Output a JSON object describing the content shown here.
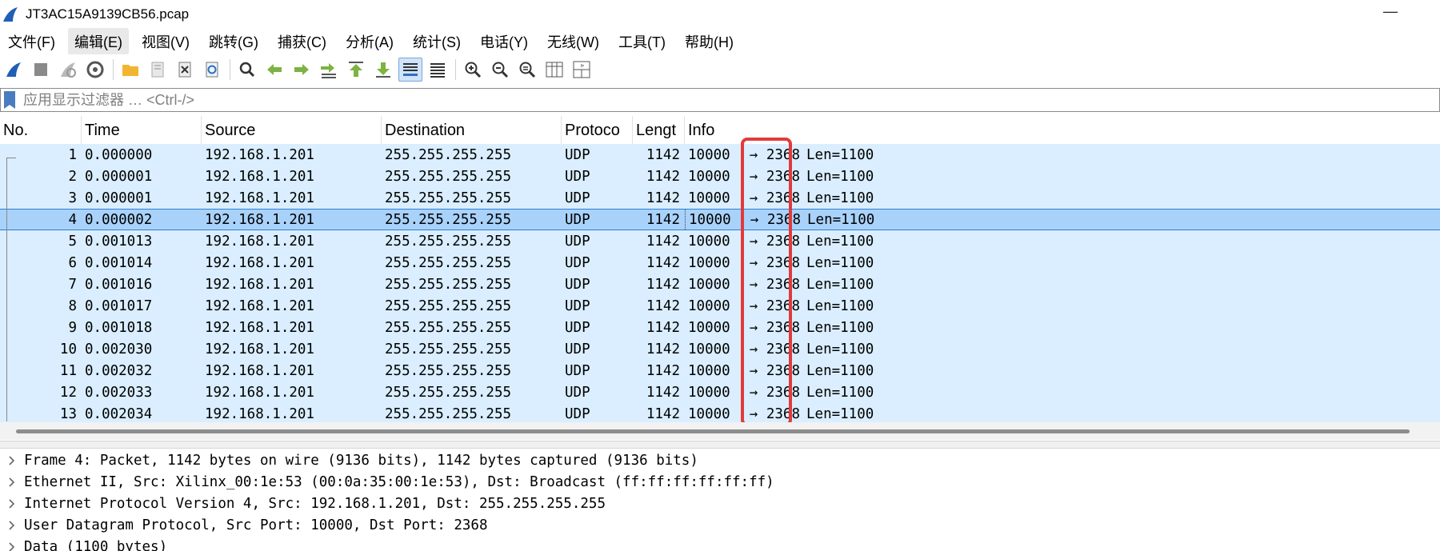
{
  "window": {
    "title": "JT3AC15A9139CB56.pcap",
    "minimize_glyph": "—"
  },
  "menu": [
    "文件(F)",
    "编辑(E)",
    "视图(V)",
    "跳转(G)",
    "捕获(C)",
    "分析(A)",
    "统计(S)",
    "电话(Y)",
    "无线(W)",
    "工具(T)",
    "帮助(H)"
  ],
  "toolbar": {
    "icons": [
      "start-capture-icon",
      "stop-capture-icon",
      "restart-capture-icon",
      "capture-options-icon",
      "open-file-icon",
      "save-file-icon",
      "close-file-icon",
      "reload-file-icon",
      "find-packet-icon",
      "go-back-icon",
      "go-forward-icon",
      "go-to-packet-icon",
      "first-packet-icon",
      "last-packet-icon",
      "auto-scroll-icon",
      "colorize-icon",
      "zoom-in-icon",
      "zoom-out-icon",
      "zoom-normal-icon",
      "resize-columns-icon",
      "layout-icon"
    ]
  },
  "filter": {
    "placeholder": "应用显示过滤器 … <Ctrl-/>"
  },
  "packet_list": {
    "columns": [
      "No.",
      "Time",
      "Source",
      "Destination",
      "Protoco",
      "Lengt",
      "Info"
    ],
    "selected_no": "4",
    "rows": [
      {
        "no": "1",
        "time": "0.000000",
        "src": "192.168.1.201",
        "dst": "255.255.255.255",
        "proto": "UDP",
        "len": "1142",
        "info_src": "10000",
        "info_arrow": "→",
        "info_dst": "2368",
        "info_rest": "Len=1100"
      },
      {
        "no": "2",
        "time": "0.000001",
        "src": "192.168.1.201",
        "dst": "255.255.255.255",
        "proto": "UDP",
        "len": "1142",
        "info_src": "10000",
        "info_arrow": "→",
        "info_dst": "2368",
        "info_rest": "Len=1100"
      },
      {
        "no": "3",
        "time": "0.000001",
        "src": "192.168.1.201",
        "dst": "255.255.255.255",
        "proto": "UDP",
        "len": "1142",
        "info_src": "10000",
        "info_arrow": "→",
        "info_dst": "2368",
        "info_rest": "Len=1100"
      },
      {
        "no": "4",
        "time": "0.000002",
        "src": "192.168.1.201",
        "dst": "255.255.255.255",
        "proto": "UDP",
        "len": "1142",
        "info_src": "10000",
        "info_arrow": "→",
        "info_dst": "2368",
        "info_rest": "Len=1100"
      },
      {
        "no": "5",
        "time": "0.001013",
        "src": "192.168.1.201",
        "dst": "255.255.255.255",
        "proto": "UDP",
        "len": "1142",
        "info_src": "10000",
        "info_arrow": "→",
        "info_dst": "2368",
        "info_rest": "Len=1100"
      },
      {
        "no": "6",
        "time": "0.001014",
        "src": "192.168.1.201",
        "dst": "255.255.255.255",
        "proto": "UDP",
        "len": "1142",
        "info_src": "10000",
        "info_arrow": "→",
        "info_dst": "2368",
        "info_rest": "Len=1100"
      },
      {
        "no": "7",
        "time": "0.001016",
        "src": "192.168.1.201",
        "dst": "255.255.255.255",
        "proto": "UDP",
        "len": "1142",
        "info_src": "10000",
        "info_arrow": "→",
        "info_dst": "2368",
        "info_rest": "Len=1100"
      },
      {
        "no": "8",
        "time": "0.001017",
        "src": "192.168.1.201",
        "dst": "255.255.255.255",
        "proto": "UDP",
        "len": "1142",
        "info_src": "10000",
        "info_arrow": "→",
        "info_dst": "2368",
        "info_rest": "Len=1100"
      },
      {
        "no": "9",
        "time": "0.001018",
        "src": "192.168.1.201",
        "dst": "255.255.255.255",
        "proto": "UDP",
        "len": "1142",
        "info_src": "10000",
        "info_arrow": "→",
        "info_dst": "2368",
        "info_rest": "Len=1100"
      },
      {
        "no": "10",
        "time": "0.002030",
        "src": "192.168.1.201",
        "dst": "255.255.255.255",
        "proto": "UDP",
        "len": "1142",
        "info_src": "10000",
        "info_arrow": "→",
        "info_dst": "2368",
        "info_rest": "Len=1100"
      },
      {
        "no": "11",
        "time": "0.002032",
        "src": "192.168.1.201",
        "dst": "255.255.255.255",
        "proto": "UDP",
        "len": "1142",
        "info_src": "10000",
        "info_arrow": "→",
        "info_dst": "2368",
        "info_rest": "Len=1100"
      },
      {
        "no": "12",
        "time": "0.002033",
        "src": "192.168.1.201",
        "dst": "255.255.255.255",
        "proto": "UDP",
        "len": "1142",
        "info_src": "10000",
        "info_arrow": "→",
        "info_dst": "2368",
        "info_rest": "Len=1100"
      },
      {
        "no": "13",
        "time": "0.002034",
        "src": "192.168.1.201",
        "dst": "255.255.255.255",
        "proto": "UDP",
        "len": "1142",
        "info_src": "10000",
        "info_arrow": "→",
        "info_dst": "2368",
        "info_rest": "Len=1100"
      }
    ]
  },
  "details": [
    "Frame 4: Packet, 1142 bytes on wire (9136 bits), 1142 bytes captured (9136 bits)",
    "Ethernet II, Src: Xilinx_00:1e:53 (00:0a:35:00:1e:53), Dst: Broadcast (ff:ff:ff:ff:ff:ff)",
    "Internet Protocol Version 4, Src: 192.168.1.201, Dst: 255.255.255.255",
    "User Datagram Protocol, Src Port: 10000, Dst Port: 2368",
    "Data (1100 bytes)"
  ],
  "colors": {
    "row_bg": "#daeeff",
    "selected_row_bg": "#a9d2fb",
    "highlight_box": "#e23a3a"
  }
}
